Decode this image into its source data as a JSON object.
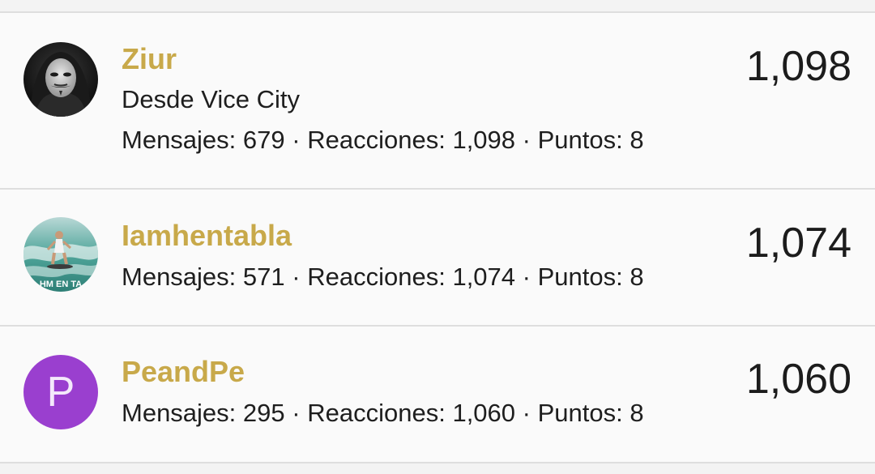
{
  "leaderboard": {
    "entries": [
      {
        "username": "Ziur",
        "title": "Desde Vice City",
        "stats": {
          "messages_label": "Mensajes:",
          "messages": "679",
          "reactions_label": "Reacciones:",
          "reactions": "1,098",
          "points_label": "Puntos:",
          "points": "8",
          "separator": "·"
        },
        "score": "1,098",
        "avatar_icon": "masked-hooded-figure-avatar"
      },
      {
        "username": "Iamhentabla",
        "stats": {
          "messages_label": "Mensajes:",
          "messages": "571",
          "reactions_label": "Reacciones:",
          "reactions": "1,074",
          "points_label": "Puntos:",
          "points": "8",
          "separator": "·"
        },
        "score": "1,074",
        "avatar_icon": "surfer-wave-avatar",
        "avatar_caption": "HM EN TA"
      },
      {
        "username": "PeandPe",
        "stats": {
          "messages_label": "Mensajes:",
          "messages": "295",
          "reactions_label": "Reacciones:",
          "reactions": "1,060",
          "points_label": "Puntos:",
          "points": "8",
          "separator": "·"
        },
        "score": "1,060",
        "avatar_letter": "P",
        "avatar_color": "#9a3fcf"
      }
    ]
  },
  "colors": {
    "username": "#c8a94a",
    "text": "#1e1e1e",
    "divider": "#dedede",
    "row_background": "#fafafa"
  }
}
